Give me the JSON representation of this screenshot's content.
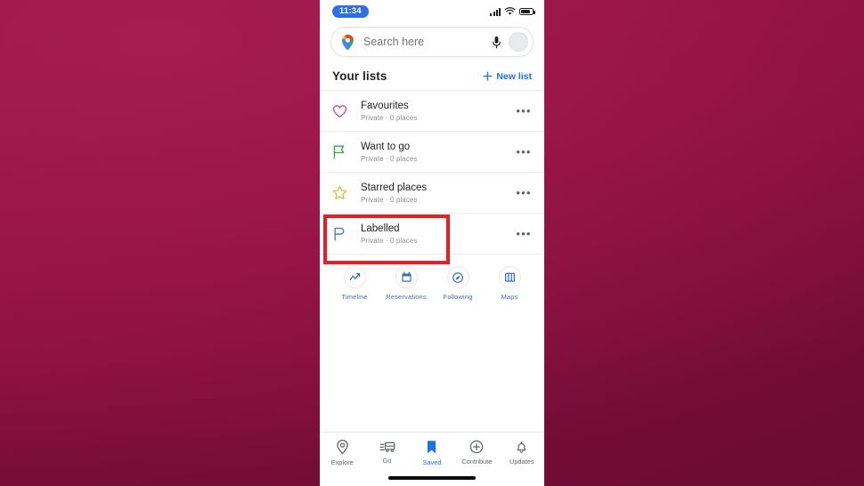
{
  "background": {
    "color": "#9a1447"
  },
  "status_bar": {
    "time": "11:34",
    "time_badge_color": "#2f6fe4",
    "icons": [
      "signal-bars-icon",
      "wifi-icon",
      "battery-icon"
    ]
  },
  "search": {
    "placeholder": "Search here",
    "logo": "google-maps-pin-icon",
    "mic": "microphone-icon",
    "avatar": "account-avatar"
  },
  "lists_header": {
    "title": "Your lists",
    "new_list_label": "New list",
    "new_list_color": "#1a73e8",
    "plus_icon": "plus-icon"
  },
  "lists": [
    {
      "name": "Favourites",
      "subtitle": "Private · 0 places",
      "icon": "heart-icon",
      "icon_color": "#d6458d",
      "menu": "•••",
      "highlighted": false
    },
    {
      "name": "Want to go",
      "subtitle": "Private · 0 places",
      "icon": "flag-icon",
      "icon_color": "#34a853",
      "menu": "•••",
      "highlighted": false
    },
    {
      "name": "Starred places",
      "subtitle": "Private · 0 places",
      "icon": "star-icon",
      "icon_color": "#e8b931",
      "menu": "•••",
      "highlighted": false
    },
    {
      "name": "Labelled",
      "subtitle": "Private · 0 places",
      "icon": "label-flag-icon",
      "icon_color": "#4a7fc1",
      "menu": "•••",
      "highlighted": true
    }
  ],
  "highlight": {
    "color": "#ee1b24",
    "target": "Labelled"
  },
  "quick_actions": [
    {
      "label": "Timeline",
      "icon": "timeline-chart-icon"
    },
    {
      "label": "Reservations",
      "icon": "calendar-icon"
    },
    {
      "label": "Following",
      "icon": "following-compass-icon"
    },
    {
      "label": "Maps",
      "icon": "folded-map-icon"
    }
  ],
  "bottom_nav": [
    {
      "label": "Explore",
      "icon": "location-pin-icon",
      "active": false
    },
    {
      "label": "Go",
      "icon": "commute-car-icon",
      "active": false
    },
    {
      "label": "Saved",
      "icon": "bookmark-icon",
      "active": true
    },
    {
      "label": "Contribute",
      "icon": "plus-circle-icon",
      "active": false
    },
    {
      "label": "Updates",
      "icon": "bell-icon",
      "active": false
    }
  ],
  "home_indicator": "home-indicator-bar"
}
